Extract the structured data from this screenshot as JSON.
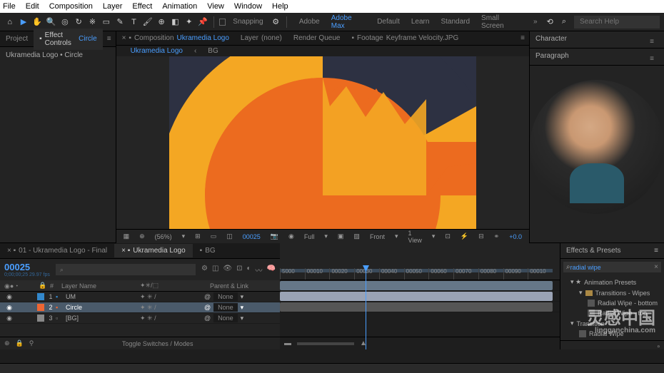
{
  "menu": [
    "File",
    "Edit",
    "Composition",
    "Layer",
    "Effect",
    "Animation",
    "View",
    "Window",
    "Help"
  ],
  "toolbar": {
    "snapping": "Snapping",
    "workspaces": [
      "Adobe",
      "Adobe Max",
      "Default",
      "Learn",
      "Standard",
      "Small Screen"
    ],
    "search_placeholder": "Search Help"
  },
  "project": {
    "tabs": {
      "project": "Project",
      "effect_controls": "Effect Controls",
      "ec_target": "Circle"
    },
    "item": "Ukramedia Logo • Circle"
  },
  "composition": {
    "tabs": {
      "comp": "Composition",
      "comp_name": "Ukramedia Logo",
      "layer": "Layer",
      "layer_name": "(none)",
      "render": "Render Queue",
      "footage": "Footage",
      "footage_name": "Keyframe Velocity.JPG"
    },
    "subtabs": {
      "main": "Ukramedia Logo",
      "bg": "BG"
    }
  },
  "viewer": {
    "zoom": "(56%)",
    "res": "Full",
    "time": "00025",
    "view": "Front",
    "views": "1 View",
    "exposure": "+0.0"
  },
  "right": {
    "character": "Character",
    "paragraph": "Paragraph"
  },
  "timeline": {
    "tabs": {
      "final": "01 - Ukramedia Logo - Final",
      "main": "Ukramedia Logo",
      "bg": "BG"
    },
    "current_time": "00025",
    "fps_label": "0;00;00;25 29.97 fps",
    "col_layer": "Layer Name",
    "col_parent": "Parent & Link",
    "layers": [
      {
        "num": "1",
        "name": "UM",
        "color": "#3388cc",
        "parent": "None"
      },
      {
        "num": "2",
        "name": "Circle",
        "color": "#ee6633",
        "parent": "None",
        "selected": true
      },
      {
        "num": "3",
        "name": "[BG]",
        "color": "#888888",
        "parent": "None"
      }
    ],
    "ruler": [
      "5000",
      "00010",
      "00020",
      "00030",
      "00040",
      "00050",
      "00060",
      "00070",
      "00080",
      "00090",
      "00010"
    ],
    "footer": "Toggle Switches / Modes"
  },
  "effects": {
    "title": "Effects & Presets",
    "search": "radial wipe",
    "tree": {
      "presets": "Animation Presets",
      "folder": "Transitions - Wipes",
      "item1": "Radial Wipe - bottom",
      "item2": "Radial Wipe - top",
      "transition": "Transition",
      "item3": "Radial Wipe"
    }
  },
  "watermark": {
    "cn": "灵感中国",
    "en": "lingganchina.com"
  }
}
